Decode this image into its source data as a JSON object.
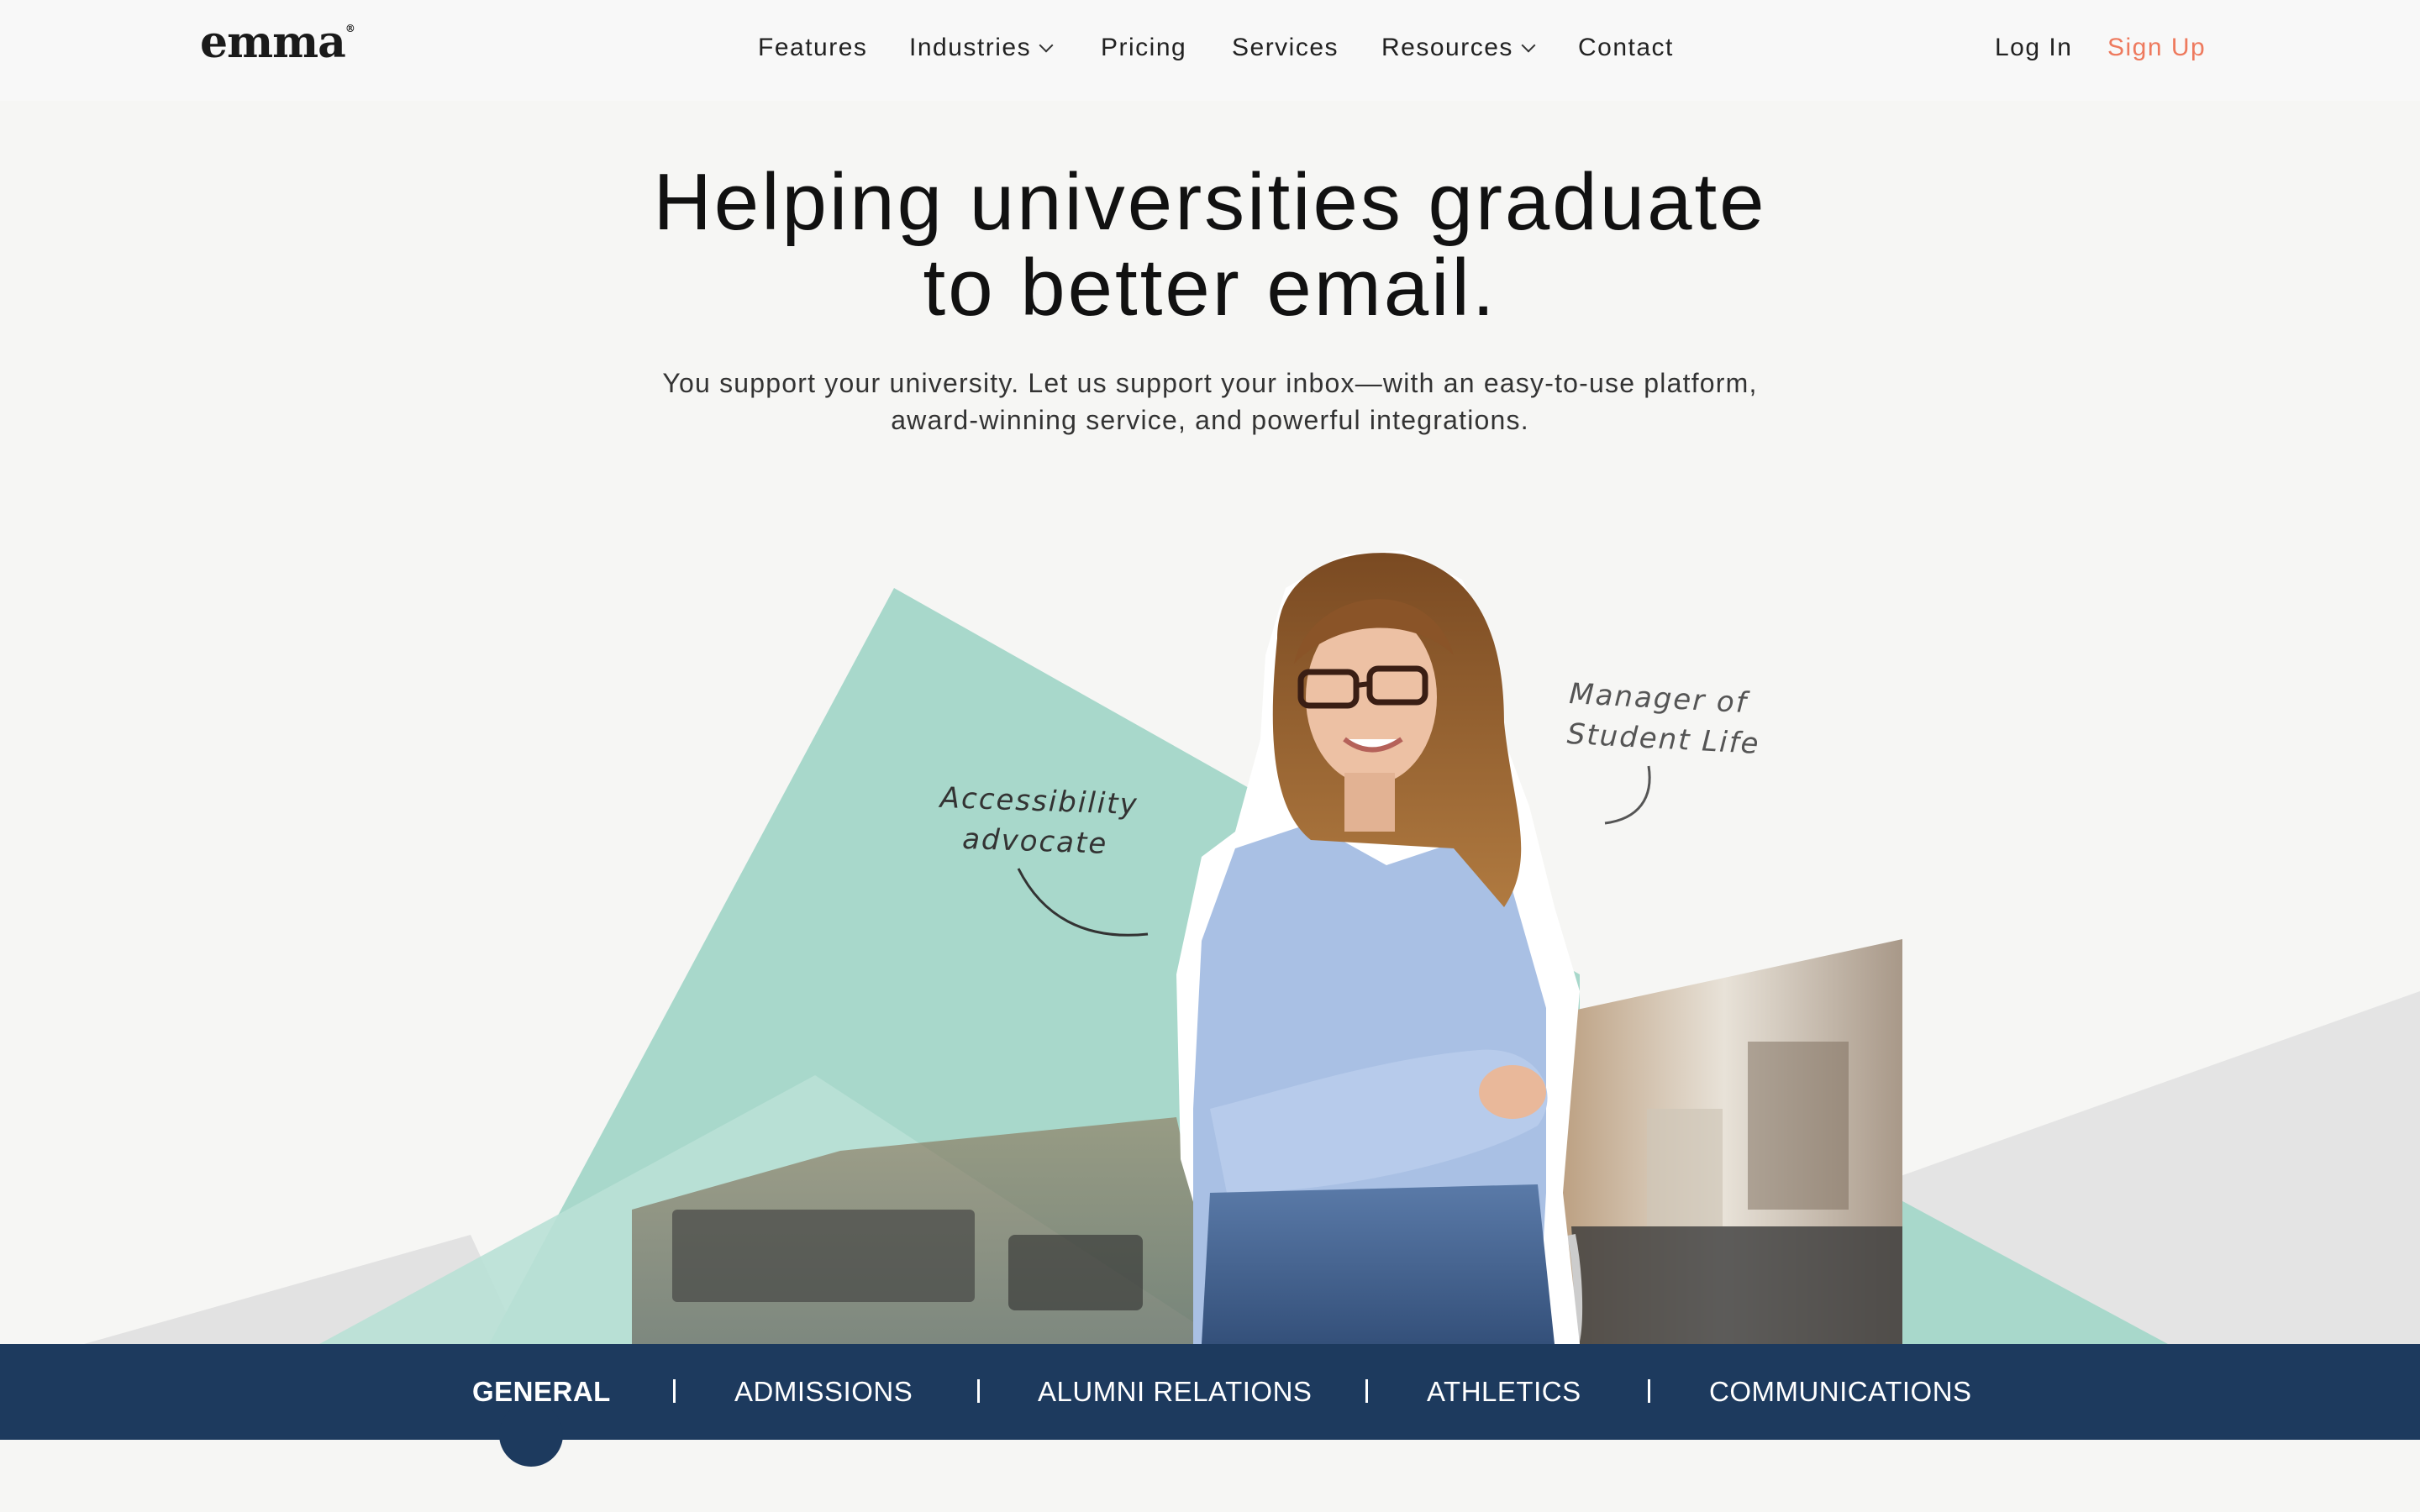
{
  "header": {
    "logo": "emma",
    "nav": [
      {
        "label": "Features"
      },
      {
        "label": "Industries"
      },
      {
        "label": "Pricing"
      },
      {
        "label": "Services"
      },
      {
        "label": "Resources"
      },
      {
        "label": "Contact"
      }
    ],
    "login_label": "Log In",
    "signup_label": "Sign Up"
  },
  "hero": {
    "title_line1": "Helping universities graduate",
    "title_line2": "to better email.",
    "subtitle_line1": "You support your university. Let us support your inbox—with an easy-to-use platform,",
    "subtitle_line2": "award-winning service, and powerful integrations."
  },
  "annotations": {
    "left_line1": "Accessibility",
    "left_line2": "advocate",
    "right_line1": "Manager of",
    "right_line2": "Student Life"
  },
  "categories": [
    {
      "label": "GENERAL",
      "active": true
    },
    {
      "label": "ADMISSIONS",
      "active": false
    },
    {
      "label": "ALUMNI RELATIONS",
      "active": false
    },
    {
      "label": "ATHLETICS",
      "active": false
    },
    {
      "label": "COMMUNICATIONS",
      "active": false
    }
  ],
  "colors": {
    "brand_navy": "#1d3a5e",
    "accent_coral": "#ee7a5e",
    "mint": "#a8d8cb"
  },
  "icons": [
    "chevron-down-icon"
  ]
}
